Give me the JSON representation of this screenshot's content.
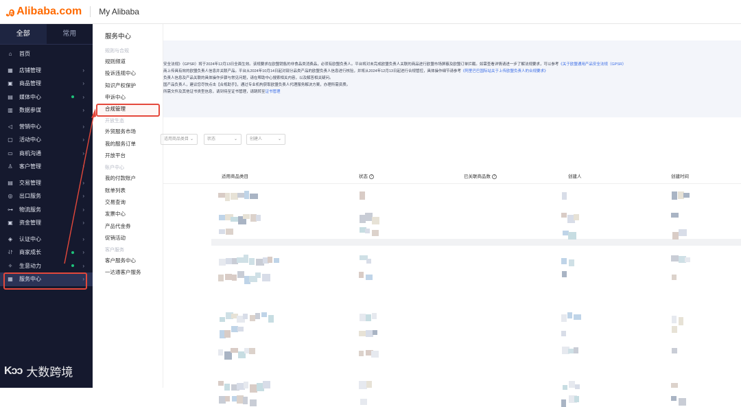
{
  "topbar": {
    "logo_text": "Alibaba.com",
    "logo_icon": "alibaba-smile-logo",
    "my_alibaba": "My Alibaba"
  },
  "sidebar": {
    "tabs": [
      "全部",
      "常用"
    ],
    "items": [
      {
        "label": "首页",
        "icon": "home-icon"
      },
      {
        "label": "店铺管理",
        "icon": "store-icon"
      },
      {
        "label": "商品管理",
        "icon": "box-icon"
      },
      {
        "label": "媒体中心",
        "icon": "media-icon"
      },
      {
        "label": "数据参谋",
        "icon": "chart-icon"
      },
      {
        "label": "营销中心",
        "icon": "megaphone-icon"
      },
      {
        "label": "活动中心",
        "icon": "calendar-icon"
      },
      {
        "label": "商机沟通",
        "icon": "chat-icon"
      },
      {
        "label": "客户管理",
        "icon": "user-icon"
      },
      {
        "label": "交易管理",
        "icon": "order-icon"
      },
      {
        "label": "出口服务",
        "icon": "globe-icon"
      },
      {
        "label": "物流服务",
        "icon": "truck-icon"
      },
      {
        "label": "资金管理",
        "icon": "wallet-icon"
      },
      {
        "label": "认证中心",
        "icon": "shield-icon"
      },
      {
        "label": "商家成长",
        "icon": "growth-icon"
      },
      {
        "label": "生意动力",
        "icon": "spark-icon"
      },
      {
        "label": "服务中心",
        "icon": "service-icon"
      }
    ],
    "active_item": "服务中心"
  },
  "submenu": {
    "title": "服务中心",
    "groups": [
      {
        "heading": "规则与合规",
        "items": [
          "规则频道",
          "投诉违规中心",
          "知识产权保护",
          "申诉中心",
          "合规管理"
        ]
      },
      {
        "heading": "开放生态",
        "items": [
          "外贸服务市场",
          "我的服务订单",
          "开放平台"
        ]
      },
      {
        "heading": "账户中心",
        "items": [
          "我的付款账户",
          "账单列表",
          "交易查询",
          "发票中心",
          "产品代金券",
          "促销活动"
        ]
      },
      {
        "heading": "客户服务",
        "items": [
          "客户服务中心",
          "一达通客户服务"
        ]
      }
    ],
    "selected_item": "合规管理"
  },
  "notice": {
    "lines": [
      {
        "text": "安全法规》（GPSR）将于2024年12月13日全面生效。该规要求在欧盟销售的非食品类消费品，必须有欧盟负责人。平台将对未完成欧盟负责人关联的商品进行欧盟市场屏蔽及欧盟订单拦截。如需查看详情请进一步了解法规要求，可以参考",
        "link": "《关于欧盟通用产品安全法规（GPSR）"
      },
      {
        "text": "商上传具有效的欧盟负责人信息并关联产品。平台从2024年10月14日起对部分品类产品的欧盟负责人信息进行核验，并将从2024年12月13日起进行合规管控，具体操作细节请参考",
        "link": "《阿里巴巴国际站关于上传欧盟负责人的合规要求》"
      },
      {
        "text": "负责人信息及产品关联的具体操作步骤与常见问题，请在帮助中心搜索相关内容，以及解答相关疑问。",
        "link": ""
      },
      {
        "text": "国产品负责人，建议您尽快点击【合规助手】，通过专业机构获取欧盟负责人代理服务解决方案，办理所需资质。",
        "link": ""
      },
      {
        "text": "所需文件及其他证书类型信息，请到待至证书管理，请跳转至",
        "link": "证书管理"
      }
    ]
  },
  "filters": [
    {
      "placeholder": "适用商品类目"
    },
    {
      "placeholder": "状态"
    },
    {
      "placeholder": "创建人"
    }
  ],
  "table": {
    "headers": [
      "适用商品类目",
      "状态",
      "已关联商品数",
      "创建人",
      "创建时间"
    ]
  },
  "watermark": {
    "logo": "Kɔɔ",
    "text": "大数跨境"
  },
  "colors": {
    "sidebar_bg": "#15192e",
    "brand": "#ff6a00",
    "highlight": "#e4483b",
    "link": "#3c6ee6"
  }
}
